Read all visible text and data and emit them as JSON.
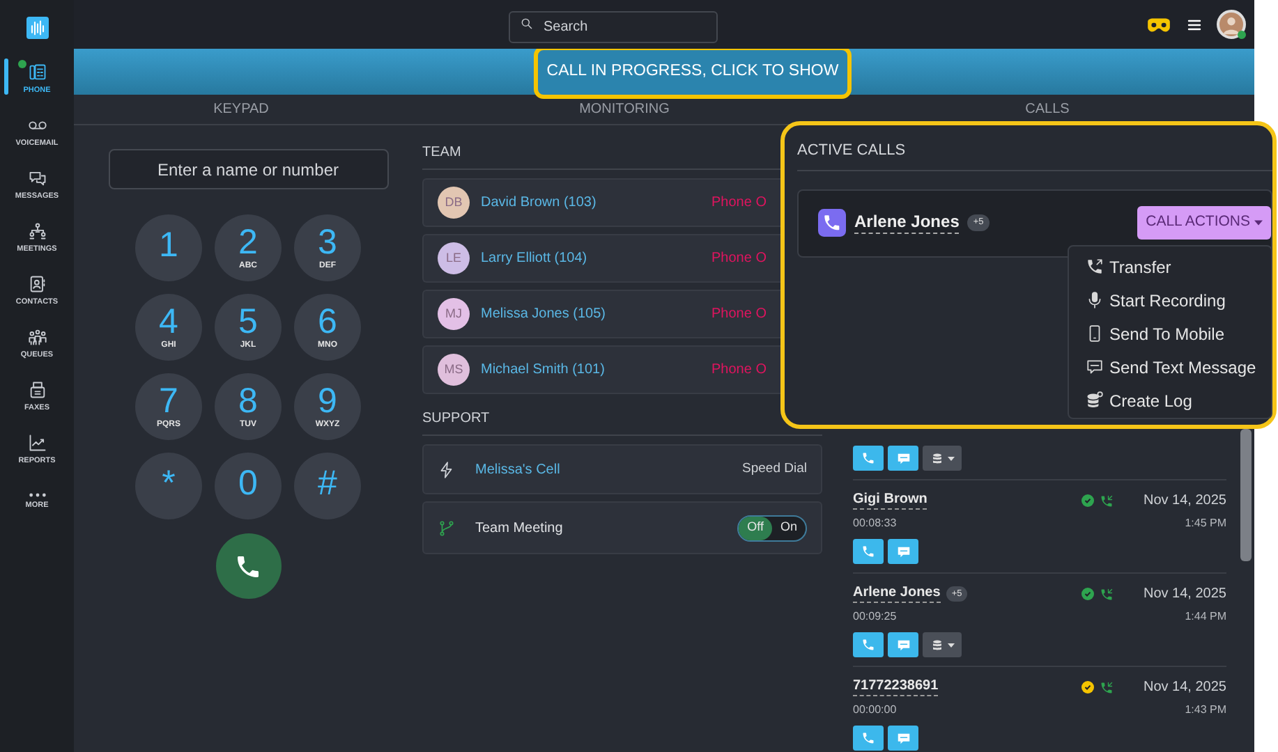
{
  "sidebar": {
    "items": [
      {
        "label": "PHONE",
        "selected": true,
        "online": true
      },
      {
        "label": "VOICEMAIL",
        "selected": false,
        "online": false
      },
      {
        "label": "MESSAGES",
        "selected": false,
        "online": false
      },
      {
        "label": "MEETINGS",
        "selected": false,
        "online": false
      },
      {
        "label": "CONTACTS",
        "selected": false,
        "online": false
      },
      {
        "label": "QUEUES",
        "selected": false,
        "online": false
      },
      {
        "label": "FAXES",
        "selected": false,
        "online": false
      },
      {
        "label": "REPORTS",
        "selected": false,
        "online": false
      },
      {
        "label": "MORE",
        "selected": false,
        "online": false
      }
    ]
  },
  "search": {
    "placeholder": "Search"
  },
  "banner": {
    "button": "CALL IN PROGRESS, CLICK TO SHOW",
    "highlighted": true
  },
  "tabs": [
    {
      "label": "KEYPAD"
    },
    {
      "label": "MONITORING"
    },
    {
      "label": "CALLS"
    }
  ],
  "keypad": {
    "placeholder": "Enter a name or number",
    "keys": [
      {
        "digit": "1"
      },
      {
        "digit": "2",
        "letters": "ABC"
      },
      {
        "digit": "3",
        "letters": "DEF"
      },
      {
        "digit": "4",
        "letters": "GHI"
      },
      {
        "digit": "5",
        "letters": "JKL"
      },
      {
        "digit": "6",
        "letters": "MNO"
      },
      {
        "digit": "7",
        "letters": "PQRS"
      },
      {
        "digit": "8",
        "letters": "TUV"
      },
      {
        "digit": "9",
        "letters": "WXYZ"
      },
      {
        "digit": "*"
      },
      {
        "digit": "0"
      },
      {
        "digit": "#"
      }
    ]
  },
  "team": {
    "title": "TEAM",
    "members": [
      {
        "initials": "DB",
        "name": "David Brown (103)",
        "status": "Phone O",
        "color": "#e2c6b2"
      },
      {
        "initials": "LE",
        "name": "Larry Elliott (104)",
        "status": "Phone O",
        "color": "#cdbde6"
      },
      {
        "initials": "MJ",
        "name": "Melissa Jones (105)",
        "status": "Phone O",
        "color": "#e3c0e6"
      },
      {
        "initials": "MS",
        "name": "Michael Smith (101)",
        "status": "Phone O",
        "color": "#e0bfdc"
      }
    ]
  },
  "support": {
    "title": "SUPPORT",
    "items": [
      {
        "kind": "speed_dial",
        "name": "Melissa's Cell",
        "type_label": "Speed Dial"
      },
      {
        "kind": "toggle",
        "name": "Team Meeting",
        "off_label": "Off",
        "on_label": "On",
        "on": false
      }
    ]
  },
  "call_history": [
    {
      "buttons": [
        {
          "kind": "call"
        },
        {
          "kind": "sms"
        },
        {
          "kind": "log"
        }
      ]
    },
    {
      "name": "Gigi Brown",
      "duration": "00:08:33",
      "color": "#2ea44f",
      "date": "Nov 14, 2025",
      "time": "1:45 PM",
      "buttons": [
        {
          "kind": "call"
        },
        {
          "kind": "sms"
        }
      ]
    },
    {
      "name": "Arlene Jones",
      "badge": "+5",
      "duration": "00:09:25",
      "color": "#2ea44f",
      "date": "Nov 14, 2025",
      "time": "1:44 PM",
      "buttons": [
        {
          "kind": "call"
        },
        {
          "kind": "sms"
        },
        {
          "kind": "log"
        }
      ]
    },
    {
      "name": "71772238691",
      "duration": "00:00:00",
      "color": "#f5c400",
      "date": "Nov 14, 2025",
      "time": "1:43 PM",
      "buttons": [
        {
          "kind": "call"
        },
        {
          "kind": "sms"
        }
      ]
    }
  ],
  "active_calls": {
    "title": "ACTIVE CALLS",
    "highlighted": true,
    "calls": [
      {
        "name": "Arlene Jones",
        "badge": "+5",
        "actions_button": "CALL ACTIONS",
        "menu_open": true,
        "menu": [
          "Transfer",
          "Start Recording",
          "Send To Mobile",
          "Send Text Message",
          "Create Log"
        ]
      }
    ]
  }
}
